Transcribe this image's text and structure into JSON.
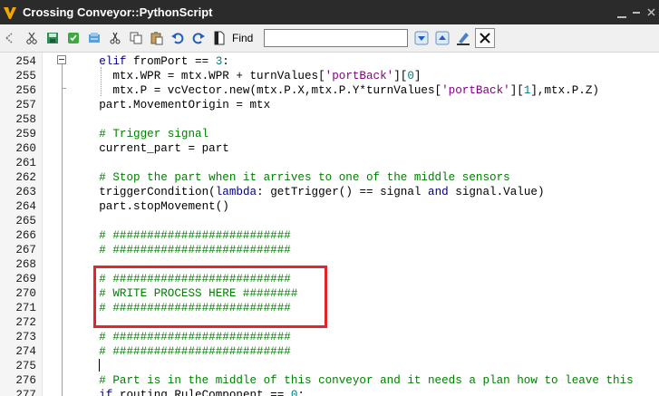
{
  "window": {
    "title": "Crossing Conveyor::PythonScript",
    "logo_letter": "V",
    "logo_color": "#f0a500",
    "controls": [
      "underline-icon",
      "minimize-icon",
      "close-icon"
    ]
  },
  "toolbar": {
    "buttons": [
      "back-icon",
      "cut-scissors-icon",
      "save-icon",
      "compile-icon",
      "export-icon",
      "cut-icon",
      "copy-icon",
      "paste-icon",
      "undo-icon",
      "redo-icon",
      "document-icon"
    ],
    "find_label": "Find",
    "find_value": "",
    "find_placeholder": "",
    "find_buttons": [
      "find-next-icon",
      "find-previous-icon",
      "highlight-icon",
      "clear-icon"
    ]
  },
  "editor": {
    "highlight_color": "#e3262d",
    "lines": [
      {
        "num": "254",
        "segments": [
          {
            "t": "    ",
            "c": "t-norm"
          },
          {
            "t": "elif",
            "c": "kw"
          },
          {
            "t": " fromPort == ",
            "c": "t-norm"
          },
          {
            "t": "3",
            "c": "nm"
          },
          {
            "t": ":",
            "c": "t-norm"
          }
        ]
      },
      {
        "num": "255",
        "segments": [
          {
            "t": "      mtx.WPR = mtx.WPR + turnValues[",
            "c": "t-norm"
          },
          {
            "t": "'portBack'",
            "c": "st"
          },
          {
            "t": "][",
            "c": "t-norm"
          },
          {
            "t": "0",
            "c": "nm"
          },
          {
            "t": "]",
            "c": "t-norm"
          }
        ]
      },
      {
        "num": "256",
        "segments": [
          {
            "t": "      mtx.P = vcVector.new(mtx.P.X,mtx.P.Y*turnValues[",
            "c": "t-norm"
          },
          {
            "t": "'portBack'",
            "c": "st"
          },
          {
            "t": "][",
            "c": "t-norm"
          },
          {
            "t": "1",
            "c": "nm"
          },
          {
            "t": "],mtx.P.Z)",
            "c": "t-norm"
          }
        ]
      },
      {
        "num": "257",
        "segments": [
          {
            "t": "    part.MovementOrigin = mtx",
            "c": "t-norm"
          }
        ]
      },
      {
        "num": "258",
        "segments": []
      },
      {
        "num": "259",
        "segments": [
          {
            "t": "    # Trigger signal",
            "c": "cm"
          }
        ]
      },
      {
        "num": "260",
        "segments": [
          {
            "t": "    current_part = part",
            "c": "t-norm"
          }
        ]
      },
      {
        "num": "261",
        "segments": []
      },
      {
        "num": "262",
        "segments": [
          {
            "t": "    # Stop the part when it arrives to one of the middle sensors",
            "c": "cm"
          }
        ]
      },
      {
        "num": "263",
        "segments": [
          {
            "t": "    triggerCondition(",
            "c": "t-norm"
          },
          {
            "t": "lambda",
            "c": "kw"
          },
          {
            "t": ": getTrigger() == signal ",
            "c": "t-norm"
          },
          {
            "t": "and",
            "c": "kw"
          },
          {
            "t": " signal.Value)",
            "c": "t-norm"
          }
        ]
      },
      {
        "num": "264",
        "segments": [
          {
            "t": "    part.stopMovement()",
            "c": "t-norm"
          }
        ]
      },
      {
        "num": "265",
        "segments": []
      },
      {
        "num": "266",
        "segments": [
          {
            "t": "    # ##########################",
            "c": "cm"
          }
        ]
      },
      {
        "num": "267",
        "segments": [
          {
            "t": "    # ##########################",
            "c": "cm"
          }
        ]
      },
      {
        "num": "268",
        "segments": []
      },
      {
        "num": "269",
        "segments": [
          {
            "t": "    # ##########################",
            "c": "cm"
          }
        ]
      },
      {
        "num": "270",
        "segments": [
          {
            "t": "    # WRITE PROCESS HERE ########",
            "c": "cm"
          }
        ]
      },
      {
        "num": "271",
        "segments": [
          {
            "t": "    # ##########################",
            "c": "cm"
          }
        ]
      },
      {
        "num": "272",
        "segments": []
      },
      {
        "num": "273",
        "segments": [
          {
            "t": "    # ##########################",
            "c": "cm"
          }
        ]
      },
      {
        "num": "274",
        "segments": [
          {
            "t": "    # ##########################",
            "c": "cm"
          }
        ]
      },
      {
        "num": "275",
        "segments": []
      },
      {
        "num": "276",
        "segments": [
          {
            "t": "    # Part is in the middle of this conveyor and it needs a plan how to leave this",
            "c": "cm"
          }
        ]
      },
      {
        "num": "277",
        "segments": [
          {
            "t": "    ",
            "c": "t-norm"
          },
          {
            "t": "if",
            "c": "kw"
          },
          {
            "t": " routing_RuleComponent == ",
            "c": "t-norm"
          },
          {
            "t": "0",
            "c": "nm"
          },
          {
            "t": ":",
            "c": "t-norm"
          }
        ]
      }
    ]
  }
}
